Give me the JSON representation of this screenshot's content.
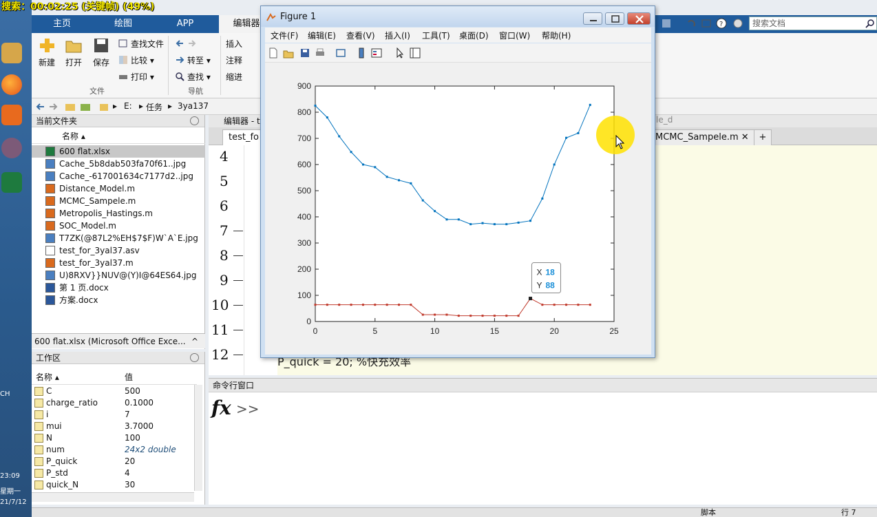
{
  "recording_banner": "搜索：00:02:25 (关键帧) (49%)",
  "os_strip": {
    "lang": "CH",
    "time": "23:09",
    "weekday": "星期一",
    "date": "21/7/12"
  },
  "ribbon": {
    "tabs": [
      "主页",
      "绘图",
      "APP",
      "编辑器"
    ],
    "file_group": {
      "new": "新建",
      "open": "打开",
      "save": "保存",
      "find_files": "查找文件",
      "compare": "比较",
      "print": "打印",
      "label": "文件"
    },
    "nav_group": {
      "goto": "转至",
      "find": "查找",
      "label": "导航"
    },
    "edit_group": {
      "insert": "插入",
      "comment": "注释",
      "indent": "缩进"
    }
  },
  "search": {
    "placeholder": "搜索文档"
  },
  "address": {
    "parts": [
      "E:",
      "任务",
      "3ya137"
    ]
  },
  "folder_panel": {
    "title": "当前文件夹",
    "column_name": "名称 ▴",
    "files": [
      {
        "name": "600 flat.xlsx",
        "icon": "excel-file-icon",
        "selected": true
      },
      {
        "name": "Cache_5b8dab503fa70f61..jpg",
        "icon": "image-file-icon"
      },
      {
        "name": "Cache_-617001634c7177d2..jpg",
        "icon": "image-file-icon"
      },
      {
        "name": "Distance_Model.m",
        "icon": "m-file-icon"
      },
      {
        "name": "MCMC_Sampele.m",
        "icon": "m-file-icon"
      },
      {
        "name": "Metropolis_Hastings.m",
        "icon": "m-file-icon"
      },
      {
        "name": "SOC_Model.m",
        "icon": "m-file-icon"
      },
      {
        "name": "T7ZK(@87L2%EH$7$F)W`A`E.jpg",
        "icon": "image-file-icon"
      },
      {
        "name": "test_for_3yal37.asv",
        "icon": "blank-file-icon"
      },
      {
        "name": "test_for_3yal37.m",
        "icon": "m-file-icon"
      },
      {
        "name": "U)8RXV}}NUV@(Y)I@64ES64.jpg",
        "icon": "image-file-icon"
      },
      {
        "name": "第 1 页.docx",
        "icon": "word-file-icon"
      },
      {
        "name": "方案.docx",
        "icon": "word-file-icon"
      }
    ],
    "details": "600 flat.xlsx  (Microsoft Office Exce..."
  },
  "workspace": {
    "title": "工作区",
    "col_name": "名称 ▴",
    "col_value": "值",
    "vars": [
      {
        "name": "C",
        "value": "500"
      },
      {
        "name": "charge_ratio",
        "value": "0.1000"
      },
      {
        "name": "i",
        "value": "7"
      },
      {
        "name": "mui",
        "value": "3.7000"
      },
      {
        "name": "N",
        "value": "100"
      },
      {
        "name": "num",
        "value": "24x2 double",
        "italic": true
      },
      {
        "name": "P_quick",
        "value": "20"
      },
      {
        "name": "P_std",
        "value": "4"
      },
      {
        "name": "quick_N",
        "value": "30"
      }
    ]
  },
  "editor": {
    "title": "编辑器 - t",
    "tab_labels": [
      "test_fo",
      "MCMC_Sampele.m"
    ],
    "ghost_tab": "le_d",
    "line_numbers": [
      "4",
      "5",
      "6",
      "7",
      "8",
      "9",
      "10",
      "11",
      "12"
    ],
    "partial_code": "P_quick = 20;      %快充效率"
  },
  "command_window": {
    "title": "命令行窗口",
    "fx": "fx",
    "prompt": ">>"
  },
  "status_bar": {
    "mode": "脚本",
    "pos": "行 7"
  },
  "figure": {
    "title": "Figure 1",
    "menus": [
      "文件(F)",
      "编辑(E)",
      "查看(V)",
      "插入(I)",
      "工具(T)",
      "桌面(D)",
      "窗口(W)",
      "帮助(H)"
    ]
  },
  "chart_data": {
    "type": "line",
    "title": "",
    "xlabel": "",
    "ylabel": "",
    "xlim": [
      0,
      25
    ],
    "ylim": [
      0,
      900
    ],
    "xticks": [
      0,
      5,
      10,
      15,
      20,
      25
    ],
    "yticks": [
      0,
      100,
      200,
      300,
      400,
      500,
      600,
      700,
      800,
      900
    ],
    "x": [
      0,
      1,
      2,
      3,
      4,
      5,
      6,
      7,
      8,
      9,
      10,
      11,
      12,
      13,
      14,
      15,
      16,
      17,
      18,
      19,
      20,
      21,
      22,
      23
    ],
    "series": [
      {
        "color": "#0072BD",
        "values": [
          825,
          780,
          708,
          648,
          600,
          590,
          553,
          540,
          528,
          463,
          422,
          390,
          390,
          372,
          376,
          372,
          372,
          378,
          385,
          470,
          600,
          702,
          720,
          828
        ]
      },
      {
        "color": "#C0392B",
        "values": [
          64,
          64,
          64,
          64,
          64,
          64,
          64,
          64,
          64,
          26,
          26,
          26,
          22,
          22,
          22,
          22,
          22,
          22,
          88,
          64,
          64,
          64,
          64,
          64
        ]
      }
    ],
    "datatip": {
      "x_label": "X",
      "x_value": "18",
      "y_label": "Y",
      "y_value": "88"
    },
    "grid": false
  }
}
